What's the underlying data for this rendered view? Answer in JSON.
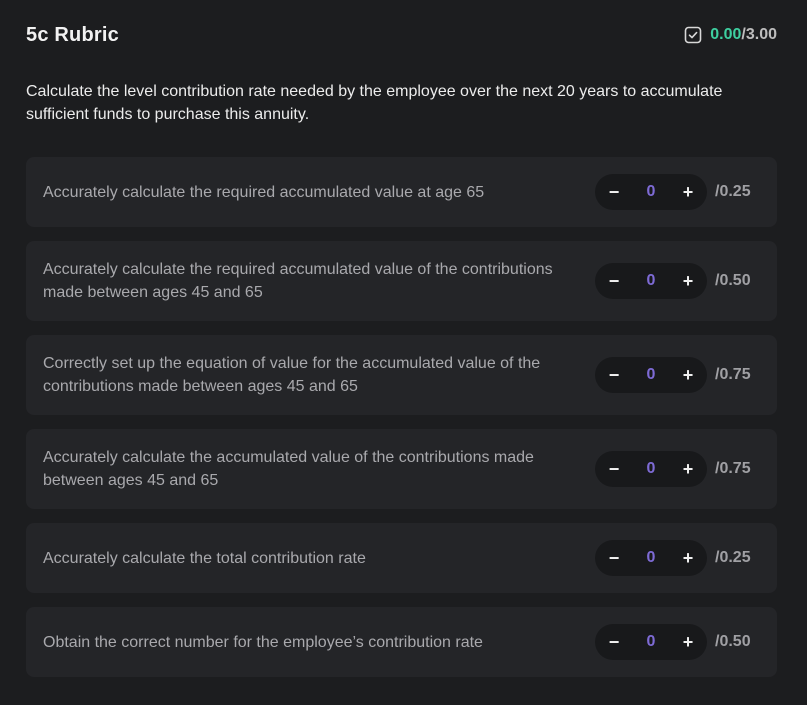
{
  "header": {
    "title": "5c Rubric",
    "score_earned": "0.00",
    "score_total": "/3.00",
    "score_icon": "check-square-icon"
  },
  "description": "Calculate the level contribution rate needed by the employee over the next 20 years to accumulate sufficient funds to purchase this annuity.",
  "colors": {
    "background": "#1c1d1f",
    "card": "#242528",
    "score_accent": "#3ecfa0",
    "stepper_value": "#7e6bd6"
  },
  "rubric_items": [
    {
      "text": "Accurately calculate the required accumulated value at age 65",
      "value": "0",
      "max": "/0.25"
    },
    {
      "text": "Accurately calculate the required accumulated value of the contributions made between ages 45 and 65",
      "value": "0",
      "max": "/0.50"
    },
    {
      "text": "Correctly set up the equation of value for the accumulated value of the contributions made between ages 45 and 65",
      "value": "0",
      "max": "/0.75"
    },
    {
      "text": "Accurately calculate the accumulated value of the contributions made between ages 45 and 65",
      "value": "0",
      "max": "/0.75"
    },
    {
      "text": "Accurately calculate the total contribution rate",
      "value": "0",
      "max": "/0.25"
    },
    {
      "text": "Obtain the correct number for the employee’s contribution rate",
      "value": "0",
      "max": "/0.50"
    }
  ],
  "stepper": {
    "decrement_label": "−",
    "increment_label": "+"
  }
}
